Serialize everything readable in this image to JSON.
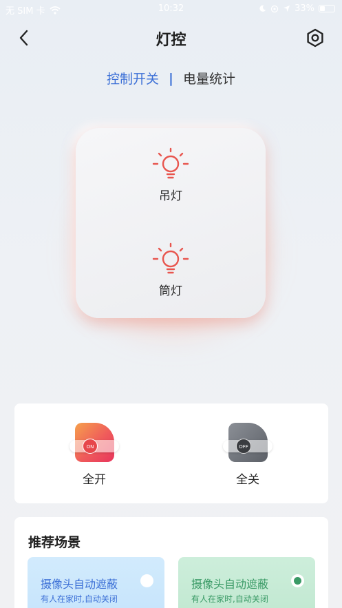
{
  "status_bar": {
    "carrier": "无 SIM 卡",
    "time": "10:32",
    "battery": "33%"
  },
  "header": {
    "title": "灯控",
    "back_icon": "chevron-left-icon",
    "settings_icon": "hexagon-settings-icon"
  },
  "tabs": {
    "active": "控制开关",
    "separator": "|",
    "inactive": "电量统计"
  },
  "lights": [
    {
      "label": "吊灯",
      "icon": "bulb-icon",
      "color": "#e8554e"
    },
    {
      "label": "筒灯",
      "icon": "bulb-icon",
      "color": "#e8554e"
    }
  ],
  "master": {
    "on_label": "全开",
    "on_knob": "ON",
    "off_label": "全关",
    "off_knob": "OFF"
  },
  "scenes": {
    "title": "推荐场景",
    "items": [
      {
        "name": "摄像头自动遮蔽",
        "subtitle": "有人在家时,自动关闭",
        "selected": false,
        "accent": "#3b6fd6"
      },
      {
        "name": "摄像头自动遮蔽",
        "subtitle": "有人在家时,自动关闭",
        "selected": true,
        "accent": "#3a9a66"
      }
    ]
  }
}
